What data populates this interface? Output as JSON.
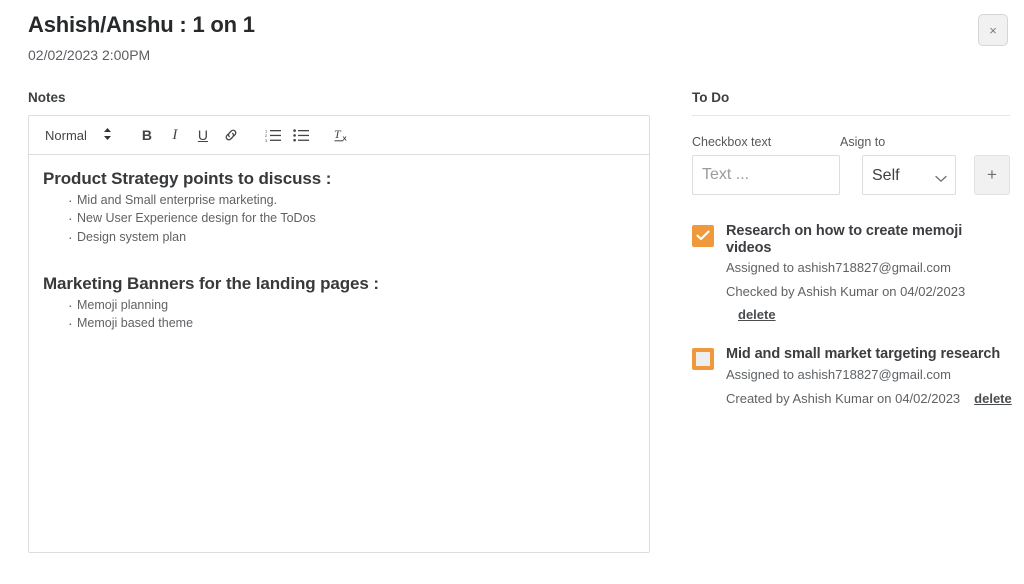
{
  "header": {
    "title": "Ashish/Anshu : 1 on 1",
    "datetime": "02/02/2023 2:00PM",
    "close_label": "×"
  },
  "notes": {
    "label": "Notes",
    "toolbar": {
      "format_value": "Normal",
      "format_arrows": "⇅",
      "bold_label": "B",
      "italic_label": "I",
      "underline_label": "U",
      "link_label": "link-icon",
      "ordered_list_label": "ordered-list-icon",
      "bullet_list_label": "bullet-list-icon",
      "clear_format_label": "clear-formatting-icon"
    },
    "blocks": [
      {
        "heading": "Product Strategy points to discuss  :",
        "items": [
          "Mid and Small enterprise marketing.",
          "New User Experience design for the ToDos",
          "Design system plan"
        ]
      },
      {
        "heading": "Marketing Banners for the landing pages  :",
        "items": [
          "Memoji planning",
          "Memoji based theme"
        ]
      }
    ]
  },
  "todo": {
    "label": "To Do",
    "form": {
      "checkbox_text_label": "Checkbox text",
      "checkbox_text_value": "",
      "checkbox_text_placeholder": "Text ...",
      "assign_label": "Asign to",
      "assign_value": "Self",
      "assign_options": [
        "Self"
      ],
      "add_label": "+"
    },
    "items": [
      {
        "checked": true,
        "title": "Research on how to create memoji videos",
        "assigned": "Assigned to ashish718827@gmail.com",
        "meta": "Checked by Ashish Kumar on 04/02/2023",
        "delete_label": "delete"
      },
      {
        "checked": false,
        "title": "Mid and small market targeting research",
        "assigned": "Assigned to ashish718827@gmail.com",
        "meta": "Created by Ashish Kumar on 04/02/2023",
        "delete_label": "delete"
      }
    ]
  },
  "colors": {
    "accent_orange": "#ef993c",
    "border_gray": "#dddddd",
    "text_dark": "#3c4043"
  }
}
